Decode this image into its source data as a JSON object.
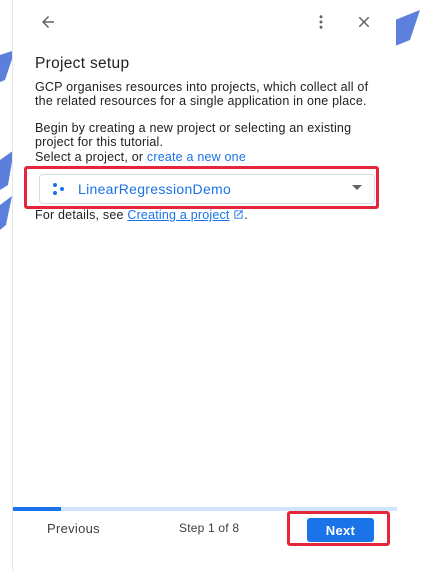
{
  "header": {
    "back_icon": "arrow-left-icon",
    "more_icon": "more-vert-icon",
    "close_icon": "close-icon"
  },
  "content": {
    "title": "Project setup",
    "paragraph1": "GCP organises resources into projects, which collect all of the related resources for a single application in one place.",
    "paragraph2": "Begin by creating a new project or selecting an existing project for this tutorial.",
    "select_prompt_prefix": "Select a project, or ",
    "create_link": "create a new one",
    "project_select": {
      "value": "LinearRegressionDemo",
      "icon": "project-icon"
    },
    "details_prefix": "For details, see ",
    "details_link": "Creating a project",
    "details_link_icon": "open-in-new-icon",
    "details_suffix": "."
  },
  "footer": {
    "previous_label": "Previous",
    "step_text": "Step 1 of 8",
    "next_label": "Next",
    "progress": 0.125
  },
  "colors": {
    "accent": "#1a73e8",
    "highlight": "#e3263b",
    "progress_track": "#d2e3fc"
  }
}
